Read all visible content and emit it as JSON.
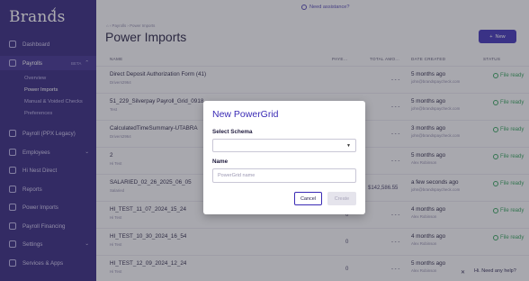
{
  "brand": {
    "name": "Brands"
  },
  "sidebar": {
    "items": [
      {
        "label": "Dashboard"
      },
      {
        "label": "Payrolls",
        "badge": "BETA"
      },
      {
        "label": "Payroll (PPX Legacy)"
      },
      {
        "label": "Employees"
      },
      {
        "label": "Hi Nest Direct"
      },
      {
        "label": "Reports"
      },
      {
        "label": "Power Imports"
      },
      {
        "label": "Payroll Financing"
      },
      {
        "label": "Settings"
      },
      {
        "label": "Services & Apps"
      }
    ],
    "payroll_sub": [
      {
        "label": "Overview"
      },
      {
        "label": "Power Imports"
      },
      {
        "label": "Manual & Voided Checks"
      },
      {
        "label": "Preferences"
      }
    ]
  },
  "topbar": {
    "help": "Need assistance?"
  },
  "page": {
    "breadcrumb": "⌂  ›  Payrolls  ›  Power Imports",
    "title": "Power Imports",
    "new_button": "New"
  },
  "table": {
    "headers": [
      "NAME",
      "PAYE...",
      "TOTAL AMO...",
      "DATE CREATED",
      "STATUS"
    ],
    "rows": [
      {
        "name": "Direct Deposit Authorization Form (41)",
        "sub": "Drivers2964",
        "payees": "",
        "total": "- - -",
        "date": "5 months ago",
        "email": "john@brandspaycheck.com",
        "status": "File ready"
      },
      {
        "name": "51_229_Silverpay Payroll_Grid_0918",
        "sub": "Test",
        "payees": "",
        "total": "- - -",
        "date": "5 months ago",
        "email": "john@brandspaycheck.com",
        "status": "File ready"
      },
      {
        "name": "CalculatedTimeSummary-UTABRA",
        "sub": "Drivers2964",
        "payees": "",
        "total": "- - -",
        "date": "3 months ago",
        "email": "john@brandspaycheck.com",
        "status": "File ready"
      },
      {
        "name": "2",
        "sub": "Hi Test",
        "payees": "",
        "total": "- - -",
        "date": "5 months ago",
        "email": "Alex Robinson",
        "status": "File ready"
      },
      {
        "name": "SALARIED_02_26_2025_06_05",
        "sub": "Salaried",
        "payees": "",
        "total": "$142,586.55",
        "date": "a few seconds ago",
        "email": "john@brandspaycheck.com",
        "status": "File ready"
      },
      {
        "name": "HI_TEST_11_07_2024_15_24",
        "sub": "Hi Test",
        "payees": "0",
        "total": "- - -",
        "date": "4 months ago",
        "email": "Alex Robinson",
        "status": "File ready"
      },
      {
        "name": "HI_TEST_10_30_2024_16_54",
        "sub": "Hi Test",
        "payees": "0",
        "total": "- - -",
        "date": "4 months ago",
        "email": "Alex Robinson",
        "status": "File ready"
      },
      {
        "name": "HI_TEST_12_09_2024_12_24",
        "sub": "Hi Test",
        "payees": "0",
        "total": "- - -",
        "date": "5 months ago",
        "email": "Alex Robinson",
        "status": ""
      }
    ]
  },
  "chat": {
    "label": "Hi. Need any help?"
  },
  "modal": {
    "title": "New PowerGrid",
    "schema_label": "Select Schema",
    "schema_value": "",
    "name_label": "Name",
    "name_placeholder": "PowerGrid name",
    "cancel": "Cancel",
    "create": "Create"
  }
}
